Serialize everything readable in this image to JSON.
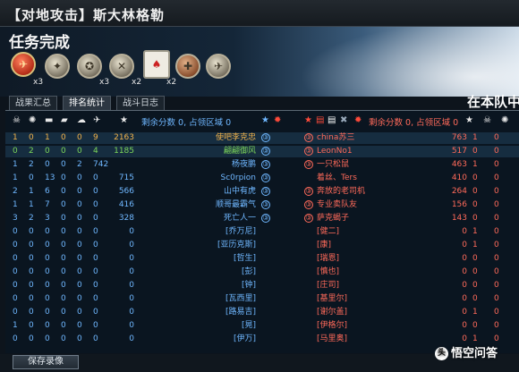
{
  "window": {
    "title": "【对地攻击】斯大林格勒"
  },
  "hero": {
    "mission_status": "任务完成"
  },
  "medals": [
    {
      "name": "red-medal",
      "count": "x3"
    },
    {
      "name": "silver-medal-1",
      "count": ""
    },
    {
      "name": "silver-medal-2",
      "count": "x3"
    },
    {
      "name": "crossed-swords-medal",
      "count": "x2"
    },
    {
      "name": "cards-badge",
      "count": "x2"
    },
    {
      "name": "round-medal",
      "count": ""
    },
    {
      "name": "plane-medal",
      "count": ""
    }
  ],
  "tabs": [
    {
      "label": "战果汇总",
      "active": false
    },
    {
      "label": "排名统计",
      "active": true
    },
    {
      "label": "战斗日志",
      "active": false
    }
  ],
  "team_label": "在本队中",
  "header": {
    "score_label_left": "剩余分数 0, 占领区域 0",
    "score_label_right": "剩余分数 0, 占领区域 0",
    "score_suffix_right": "0"
  },
  "left_team": [
    {
      "stats": [
        "1",
        "0",
        "1",
        "0",
        "0",
        "9",
        "2163"
      ],
      "name": "使吧李克忠",
      "name_color": "#f2b24a",
      "rank": "③"
    },
    {
      "stats": [
        "0",
        "2",
        "0",
        "0",
        "0",
        "4",
        "1185"
      ],
      "name": "翩翩御风",
      "name_color": "#7dd65a",
      "rank": "③"
    },
    {
      "stats": [
        "1",
        "2",
        "0",
        "0",
        "2",
        "742",
        ""
      ],
      "name": "杨夜鹏",
      "name_color": "#6fb7ff",
      "rank": "③"
    },
    {
      "stats": [
        "1",
        "0",
        "13",
        "0",
        "0",
        "0",
        "715"
      ],
      "name": "Sc0rpion",
      "name_color": "#6fb7ff",
      "rank": "③"
    },
    {
      "stats": [
        "2",
        "1",
        "6",
        "0",
        "0",
        "0",
        "566"
      ],
      "name": "山中有虎",
      "name_color": "#6fb7ff",
      "rank": "③"
    },
    {
      "stats": [
        "1",
        "1",
        "7",
        "0",
        "0",
        "0",
        "416"
      ],
      "name": "顺哥最霸气",
      "name_color": "#6fb7ff",
      "rank": "③"
    },
    {
      "stats": [
        "3",
        "2",
        "3",
        "0",
        "0",
        "0",
        "328"
      ],
      "name": "死亡人一",
      "name_color": "#6fb7ff",
      "rank": "③"
    },
    {
      "stats": [
        "0",
        "0",
        "0",
        "0",
        "0",
        "0",
        "0"
      ],
      "name": "[乔万尼]",
      "name_color": "#6fb7ff",
      "rank": ""
    },
    {
      "stats": [
        "0",
        "0",
        "0",
        "0",
        "0",
        "0",
        "0"
      ],
      "name": "[亚历克斯]",
      "name_color": "#6fb7ff",
      "rank": ""
    },
    {
      "stats": [
        "0",
        "0",
        "0",
        "0",
        "0",
        "0",
        "0"
      ],
      "name": "[哲生]",
      "name_color": "#6fb7ff",
      "rank": ""
    },
    {
      "stats": [
        "0",
        "0",
        "0",
        "0",
        "0",
        "0",
        "0"
      ],
      "name": "[彭]",
      "name_color": "#6fb7ff",
      "rank": ""
    },
    {
      "stats": [
        "0",
        "0",
        "0",
        "0",
        "0",
        "0",
        "0"
      ],
      "name": "[钟]",
      "name_color": "#6fb7ff",
      "rank": ""
    },
    {
      "stats": [
        "0",
        "0",
        "0",
        "0",
        "0",
        "0",
        "0"
      ],
      "name": "[瓦西里]",
      "name_color": "#6fb7ff",
      "rank": ""
    },
    {
      "stats": [
        "0",
        "0",
        "0",
        "0",
        "0",
        "0",
        "0"
      ],
      "name": "[路易吉]",
      "name_color": "#6fb7ff",
      "rank": ""
    },
    {
      "stats": [
        "1",
        "0",
        "0",
        "0",
        "0",
        "0",
        "0"
      ],
      "name": "[晃]",
      "name_color": "#6fb7ff",
      "rank": ""
    },
    {
      "stats": [
        "0",
        "0",
        "0",
        "0",
        "0",
        "0",
        "0"
      ],
      "name": "[伊万]",
      "name_color": "#6fb7ff",
      "rank": ""
    }
  ],
  "right_team": [
    {
      "rank": "③",
      "name": "china苏三",
      "name_color": "#ff6a5a",
      "stats": [
        "763",
        "1",
        "0"
      ]
    },
    {
      "rank": "③",
      "name": "LeonNo1",
      "name_color": "#ff6a5a",
      "stats": [
        "517",
        "0",
        "0"
      ]
    },
    {
      "rank": "③",
      "name": "一只松鼠",
      "name_color": "#ff6a5a",
      "stats": [
        "463",
        "1",
        "0"
      ]
    },
    {
      "rank": "",
      "name": "着丝、Ters",
      "name_color": "#ff6a5a",
      "stats": [
        "410",
        "0",
        "0"
      ]
    },
    {
      "rank": "③",
      "name": "奔放的老司机",
      "name_color": "#ff6a5a",
      "stats": [
        "264",
        "0",
        "0"
      ]
    },
    {
      "rank": "③",
      "name": "专业卖队友",
      "name_color": "#ff6a5a",
      "stats": [
        "156",
        "0",
        "0"
      ]
    },
    {
      "rank": "③",
      "name": "萨克蝎子",
      "name_color": "#ff6a5a",
      "stats": [
        "143",
        "0",
        "0"
      ]
    },
    {
      "rank": "",
      "name": "[健二]",
      "name_color": "#ff6a5a",
      "stats": [
        "0",
        "1",
        "0"
      ]
    },
    {
      "rank": "",
      "name": "[康]",
      "name_color": "#ff6a5a",
      "stats": [
        "0",
        "1",
        "0"
      ]
    },
    {
      "rank": "",
      "name": "[瑞恩]",
      "name_color": "#ff6a5a",
      "stats": [
        "0",
        "0",
        "0"
      ]
    },
    {
      "rank": "",
      "name": "[慎也]",
      "name_color": "#ff6a5a",
      "stats": [
        "0",
        "0",
        "0"
      ]
    },
    {
      "rank": "",
      "name": "[庄司]",
      "name_color": "#ff6a5a",
      "stats": [
        "0",
        "0",
        "0"
      ]
    },
    {
      "rank": "",
      "name": "[基里尔]",
      "name_color": "#ff6a5a",
      "stats": [
        "0",
        "0",
        "0"
      ]
    },
    {
      "rank": "",
      "name": "[谢尔盖]",
      "name_color": "#ff6a5a",
      "stats": [
        "0",
        "1",
        "0"
      ]
    },
    {
      "rank": "",
      "name": "[伊格尔]",
      "name_color": "#ff6a5a",
      "stats": [
        "0",
        "0",
        "0"
      ]
    },
    {
      "rank": "",
      "name": "[马里奥]",
      "name_color": "#ff6a5a",
      "stats": [
        "0",
        "1",
        "0"
      ]
    }
  ],
  "bottom": {
    "save_replay": "保存录像"
  },
  "watermark": {
    "text": "悟空问答",
    "logo": "头"
  }
}
